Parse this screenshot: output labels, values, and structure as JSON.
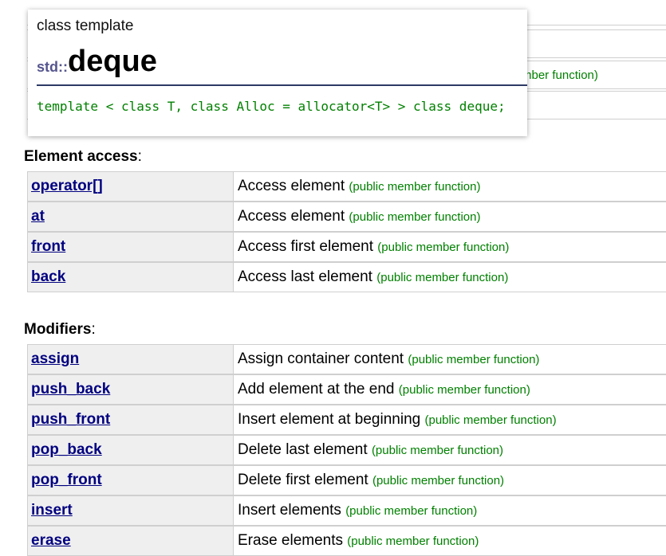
{
  "popup": {
    "kind": "class template",
    "namespace": "std::",
    "name": "deque",
    "signature": "template < class T, class Alloc = allocator<T> > class deque;"
  },
  "background_partial": {
    "tag_fragment": "mber function)"
  },
  "element_access": {
    "title": "Element access",
    "colon": ":",
    "rows": [
      {
        "name": "operator[]",
        "desc": "Access element",
        "tag": "(public member function)"
      },
      {
        "name": "at",
        "desc": "Access element",
        "tag": "(public member function)"
      },
      {
        "name": "front",
        "desc": "Access first element",
        "tag": "(public member function)"
      },
      {
        "name": "back",
        "desc": "Access last element",
        "tag": "(public member function)"
      }
    ]
  },
  "modifiers": {
    "title": "Modifiers",
    "colon": ":",
    "rows": [
      {
        "name": "assign",
        "desc": "Assign container content",
        "tag": "(public member function)"
      },
      {
        "name": "push_back",
        "desc": "Add element at the end",
        "tag": "(public member function)"
      },
      {
        "name": "push_front",
        "desc": "Insert element at beginning",
        "tag": "(public member function)"
      },
      {
        "name": "pop_back",
        "desc": "Delete last element",
        "tag": "(public member function)"
      },
      {
        "name": "pop_front",
        "desc": "Delete first element",
        "tag": "(public member function)"
      },
      {
        "name": "insert",
        "desc": "Insert elements",
        "tag": "(public member function)"
      },
      {
        "name": "erase",
        "desc": "Erase elements",
        "tag": "(public member function)"
      }
    ]
  }
}
